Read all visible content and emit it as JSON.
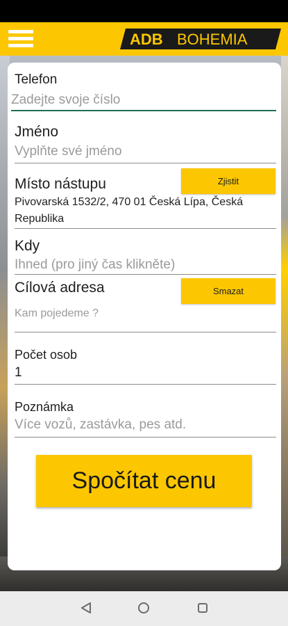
{
  "header": {
    "brand_prefix": "ADB",
    "brand_name": "BOHEMIA",
    "menu_icon": "hamburger-menu-icon",
    "brand_color": "#fcc700"
  },
  "form": {
    "phone": {
      "label": "Telefon",
      "placeholder": "Zadejte svoje číslo"
    },
    "name": {
      "label": "Jméno",
      "placeholder": "Vyplňte své jméno"
    },
    "pickup": {
      "label": "Místo nástupu",
      "button": "Zjistit",
      "value": "Pivovarská 1532/2, 470 01 Česká Lípa, Česká Republika"
    },
    "when": {
      "label": "Kdy",
      "placeholder": "Ihned (pro jiný čas klikněte)"
    },
    "destination": {
      "label": "Cílová adresa",
      "button": "Smazat",
      "placeholder": "Kam pojedeme ?"
    },
    "persons": {
      "label": "Počet osob",
      "value": "1"
    },
    "note": {
      "label": "Poznámka",
      "placeholder": "Více vozů, zastávka, pes atd."
    },
    "submit": "Spočítat cenu"
  },
  "navigation": {
    "back_icon": "back-triangle-icon",
    "home_icon": "home-circle-icon",
    "recents_icon": "recents-square-icon"
  }
}
